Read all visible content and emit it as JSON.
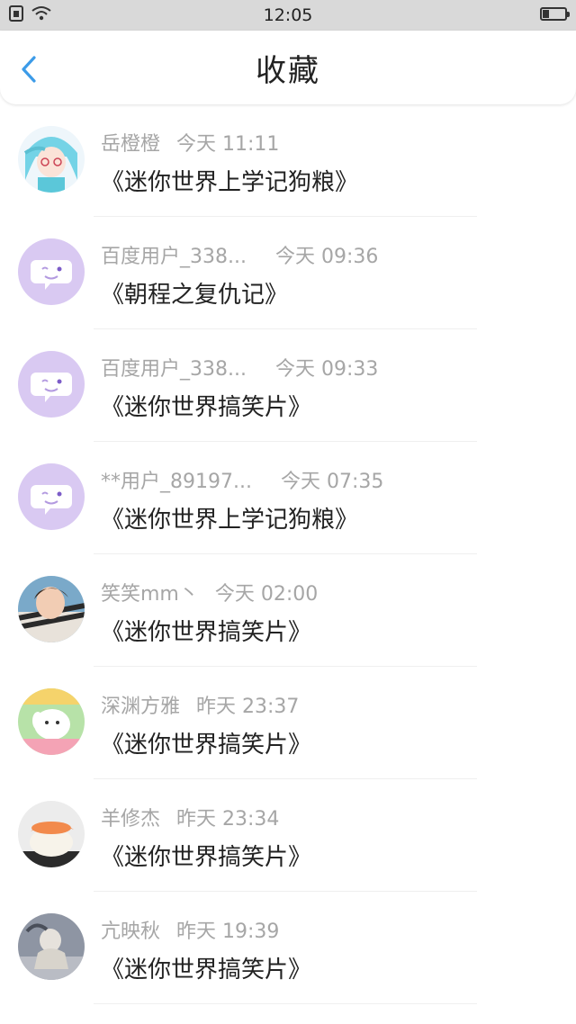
{
  "status_bar": {
    "time": "12:05",
    "battery_level": 0.3
  },
  "header": {
    "title": "收藏",
    "back_icon": "chevron-left-icon"
  },
  "colors": {
    "accent": "#3c9be8",
    "meta_text": "#a6a6a6",
    "default_avatar": "#d9c9f2"
  },
  "items": [
    {
      "user": "岳橙橙",
      "time": "今天 11:11",
      "title": "《迷你世界上学记狗粮》",
      "avatar": "anime-girl-avatar"
    },
    {
      "user": "百度用户_338...",
      "time": "今天 09:36",
      "title": "《朝程之复仇记》",
      "avatar": "default-chat-avatar"
    },
    {
      "user": "百度用户_338...",
      "time": "今天 09:33",
      "title": "《迷你世界搞笑片》",
      "avatar": "default-chat-avatar"
    },
    {
      "user": "**用户_89197...",
      "time": "今天 07:35",
      "title": "《迷你世界上学记狗粮》",
      "avatar": "default-chat-avatar"
    },
    {
      "user": "笑笑mm丶",
      "time": "今天 02:00",
      "title": "《迷你世界搞笑片》",
      "avatar": "photo-avatar"
    },
    {
      "user": "深渊方雅",
      "time": "昨天 23:37",
      "title": "《迷你世界搞笑片》",
      "avatar": "cartoon-avatar"
    },
    {
      "user": "羊修杰",
      "time": "昨天 23:34",
      "title": "《迷你世界搞笑片》",
      "avatar": "food-avatar"
    },
    {
      "user": "亢映秋",
      "time": "昨天 19:39",
      "title": "《迷你世界搞笑片》",
      "avatar": "figure-avatar"
    }
  ]
}
